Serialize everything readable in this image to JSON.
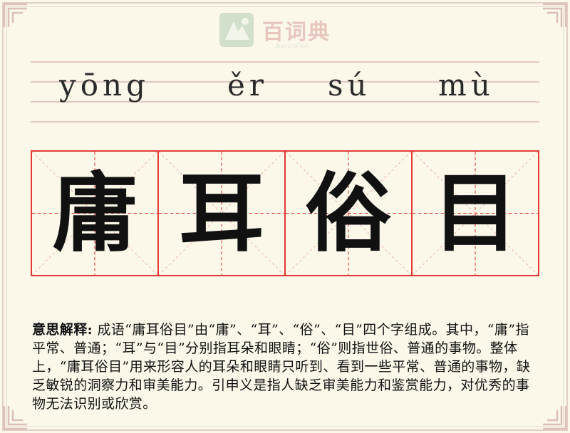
{
  "logo": {
    "text": "百词典",
    "subtext": "baicidian"
  },
  "pinyin": [
    "yōng",
    "ěr",
    "sú",
    "mù"
  ],
  "characters": [
    "庸",
    "耳",
    "俗",
    "目"
  ],
  "explanation": {
    "label": "意思解释:",
    "text": "成语“庸耳俗目”由“庸”、“耳”、“俗”、“目”四个字组成。其中，“庸”指平常、普通；“耳”与“目”分别指耳朵和眼睛；“俗”则指世俗、普通的事物。整体上，“庸耳俗目”用来形容人的耳朵和眼睛只听到、看到一些平常、普通的事物，缺乏敏锐的洞察力和审美能力。引申义是指人缺乏审美能力和鉴赏能力，对优秀的事物无法识别或欣赏。"
  },
  "colors": {
    "grid_border": "#e53935",
    "guide_dash": "#e53935",
    "pinyin_line": "#e5c7c3",
    "background": "#fbf8ea"
  }
}
